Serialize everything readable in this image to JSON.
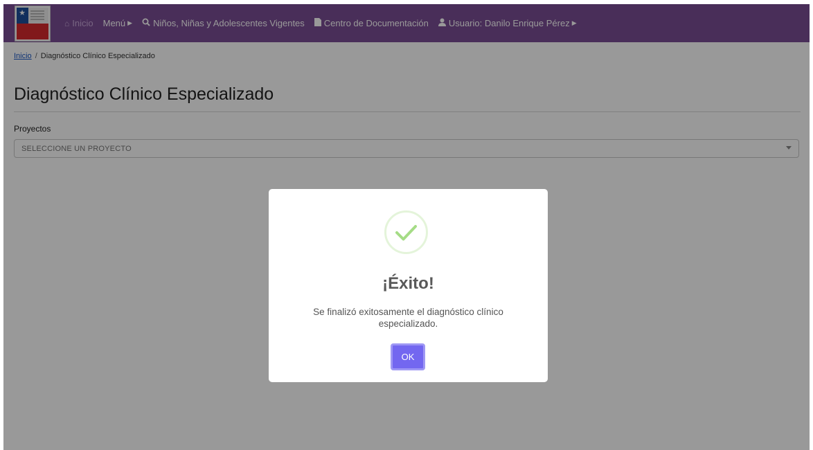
{
  "navbar": {
    "items": [
      {
        "label": "Inicio",
        "icon": "home-icon"
      },
      {
        "label": "Menú",
        "icon": "caret-right-icon"
      },
      {
        "label": "Niños, Niñas y Adolescentes Vigentes",
        "icon": "search-icon"
      },
      {
        "label": "Centro de Documentación",
        "icon": "file-icon"
      },
      {
        "label": "Usuario: Danilo Enrique Pérez",
        "icon": "user-icon"
      }
    ]
  },
  "breadcrumb": {
    "home": "Inicio",
    "separator": "/",
    "current": "Diagnóstico Clínico Especializado"
  },
  "page": {
    "title": "Diagnóstico Clínico Especializado"
  },
  "form": {
    "projects_label": "Proyectos",
    "projects_value": "SELECCIONE UN PROYECTO"
  },
  "modal": {
    "title": "¡Éxito!",
    "message": "Se finalizó exitosamente el diagnóstico clínico especializado.",
    "ok_label": "OK",
    "icon": "success-check-icon"
  },
  "colors": {
    "navbar": "#7a4d94",
    "ok_button": "#7367f0",
    "success": "#a5dc86"
  }
}
